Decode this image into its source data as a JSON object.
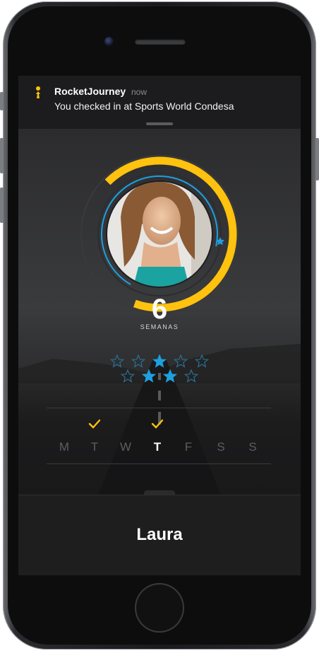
{
  "notification": {
    "app_name": "RocketJourney",
    "time": "now",
    "message": "You checked in at Sports World Condesa"
  },
  "progress": {
    "weeks_value": "6",
    "weeks_label": "SEMANAS",
    "outer_ring_fraction": 0.68,
    "inner_ring_fraction": 0.7
  },
  "stars": {
    "row1_filled": [
      false,
      false,
      true,
      false,
      false
    ],
    "row2_filled": [
      false,
      true,
      true,
      false
    ]
  },
  "week": {
    "days": [
      {
        "label": "M",
        "checked": false,
        "active": false
      },
      {
        "label": "T",
        "checked": true,
        "active": false
      },
      {
        "label": "W",
        "checked": false,
        "active": false
      },
      {
        "label": "T",
        "checked": true,
        "active": true
      },
      {
        "label": "F",
        "checked": false,
        "active": false
      },
      {
        "label": "S",
        "checked": false,
        "active": false
      },
      {
        "label": "S",
        "checked": false,
        "active": false
      }
    ]
  },
  "profile": {
    "name": "Laura"
  },
  "colors": {
    "accent_yellow": "#ffc20e",
    "accent_blue": "#1e9fe0",
    "background": "#1f1f21"
  }
}
